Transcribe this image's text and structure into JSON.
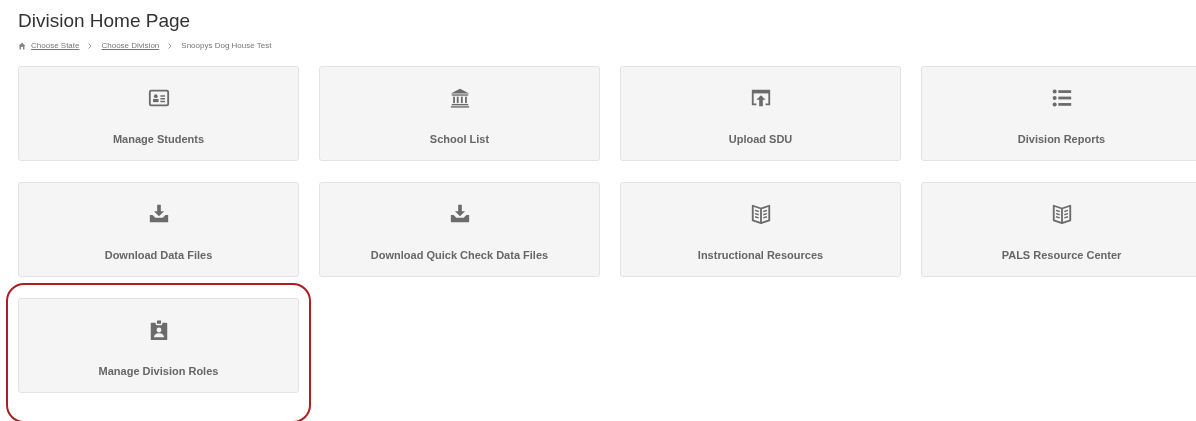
{
  "page_title": "Division Home Page",
  "breadcrumb": [
    {
      "label": "Choose State",
      "kind": "link"
    },
    {
      "label": "Choose Division",
      "kind": "link"
    },
    {
      "label": "Snoopys Dog House Test",
      "kind": "current"
    }
  ],
  "tiles": [
    {
      "label": "Manage Students",
      "kind": "id-card",
      "highlighted": false
    },
    {
      "label": "School List",
      "kind": "bank",
      "highlighted": false
    },
    {
      "label": "Upload SDU",
      "kind": "upload",
      "highlighted": false
    },
    {
      "label": "Division Reports",
      "kind": "list",
      "highlighted": false
    },
    {
      "label": "Download Data Files",
      "kind": "download",
      "highlighted": false
    },
    {
      "label": "Download Quick Check Data Files",
      "kind": "download",
      "highlighted": false
    },
    {
      "label": "Instructional Resources",
      "kind": "book",
      "highlighted": false
    },
    {
      "label": "PALS Resource Center",
      "kind": "book",
      "highlighted": false
    },
    {
      "label": "Manage Division Roles",
      "kind": "badge",
      "highlighted": true
    }
  ]
}
